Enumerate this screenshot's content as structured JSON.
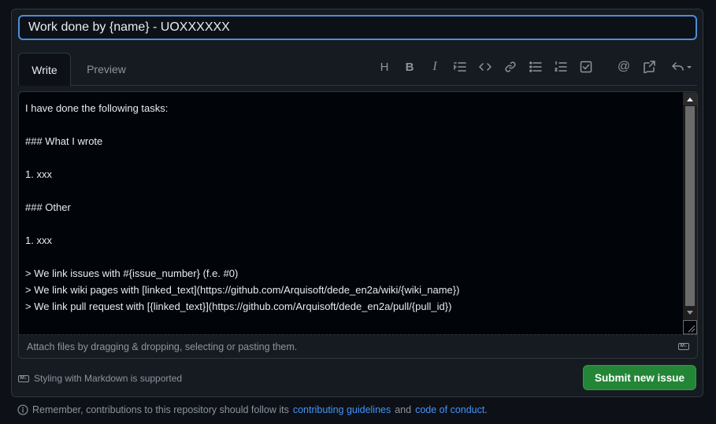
{
  "issue": {
    "title_value": "Work done by {name} - UOXXXXXX"
  },
  "tabs": [
    {
      "label": "Write"
    },
    {
      "label": "Preview"
    }
  ],
  "toolbar": {
    "icons": [
      "heading-icon",
      "bold-icon",
      "italic-icon",
      "quote-icon",
      "code-icon",
      "link-icon",
      "bulleted-list-icon",
      "numbered-list-icon",
      "task-list-icon",
      "mention-icon",
      "reference-icon",
      "undo-icon"
    ],
    "heading_glyph": "H",
    "bold_glyph": "B",
    "italic_glyph": "I",
    "mention_glyph": "@"
  },
  "editor": {
    "body": "I have done the following tasks:\n\n### What I wrote\n\n1. xxx\n\n### Other\n\n1. xxx\n\n> We link issues with #{issue_number} (f.e. #0)\n> We link wiki pages with [linked_text](https://github.com/Arquisoft/dede_en2a/wiki/{wiki_name})\n> We link pull request with [{linked_text}](https://github.com/Arquisoft/dede_en2a/pull/{pull_id})",
    "attach_hint": "Attach files by dragging & dropping, selecting or pasting them."
  },
  "footer": {
    "markdown_note": "Styling with Markdown is supported",
    "submit_label": "Submit new issue",
    "notice_prefix": "Remember, contributions to this repository should follow its",
    "guidelines_link": "contributing guidelines",
    "notice_and": "and",
    "conduct_link": "code of conduct",
    "notice_end": "."
  },
  "colors": {
    "background": "#0d1117",
    "accent_focus": "#4b8fdb",
    "submit_green": "#238636",
    "link_blue": "#4493f8"
  }
}
